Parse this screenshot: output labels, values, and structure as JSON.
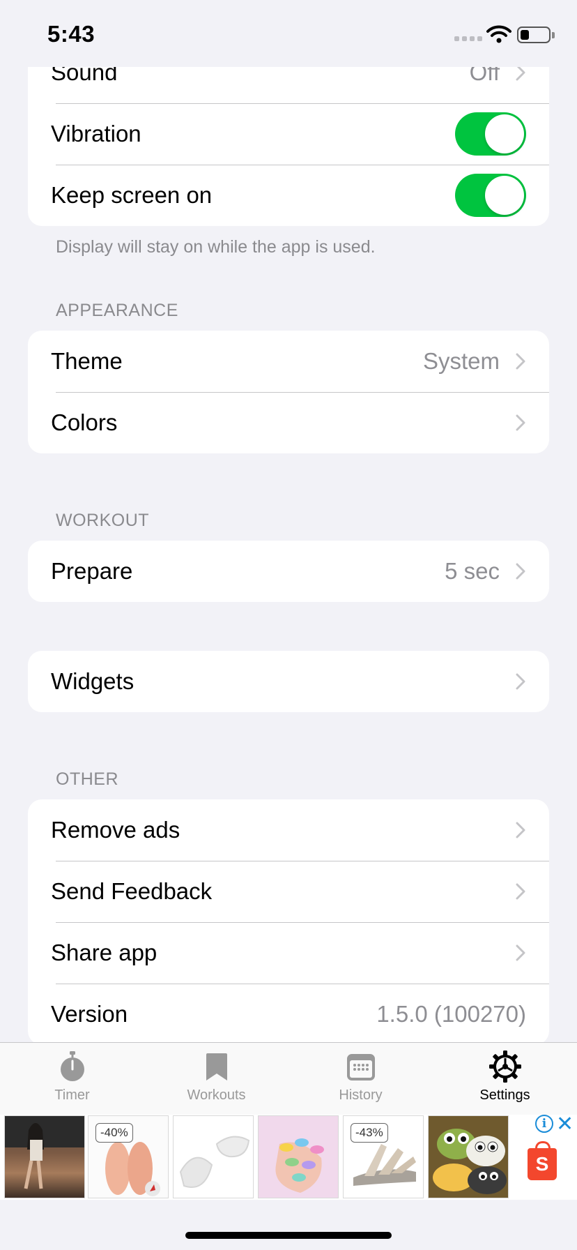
{
  "status_bar": {
    "time": "5:43"
  },
  "sections": {
    "general": {
      "rows": [
        {
          "label": "Sound",
          "value": "Off"
        },
        {
          "label": "Vibration"
        },
        {
          "label": "Keep screen on"
        }
      ],
      "vibration_on": true,
      "keep_screen_on": true,
      "footnote": "Display will stay on while the app is used."
    },
    "appearance": {
      "header": "APPEARANCE",
      "rows": [
        {
          "label": "Theme",
          "value": "System"
        },
        {
          "label": "Colors"
        }
      ]
    },
    "workout": {
      "header": "WORKOUT",
      "rows": [
        {
          "label": "Prepare",
          "value": "5 sec"
        }
      ]
    },
    "widgets": {
      "rows": [
        {
          "label": "Widgets"
        }
      ]
    },
    "other": {
      "header": "OTHER",
      "rows": [
        {
          "label": "Remove ads"
        },
        {
          "label": "Send Feedback"
        },
        {
          "label": "Share app"
        },
        {
          "label": "Version",
          "value": "1.5.0 (100270)"
        }
      ]
    }
  },
  "tab_bar": {
    "tabs": [
      {
        "label": "Timer",
        "icon": "stopwatch-icon"
      },
      {
        "label": "Workouts",
        "icon": "bookmark-icon"
      },
      {
        "label": "History",
        "icon": "calendar-icon"
      },
      {
        "label": "Settings",
        "icon": "gear-icon"
      }
    ],
    "active": "Settings"
  },
  "ad_banner": {
    "badges": [
      "-40%",
      "-43%"
    ],
    "store_logo_letter": "S",
    "info_glyph": "i",
    "close_glyph": "✕"
  },
  "colors": {
    "toggle_on": "#00c43f",
    "background": "#f2f2f7",
    "secondary_text": "#8e8e93",
    "ad_accent": "#1a8cd8",
    "store_brand": "#f3472d"
  }
}
